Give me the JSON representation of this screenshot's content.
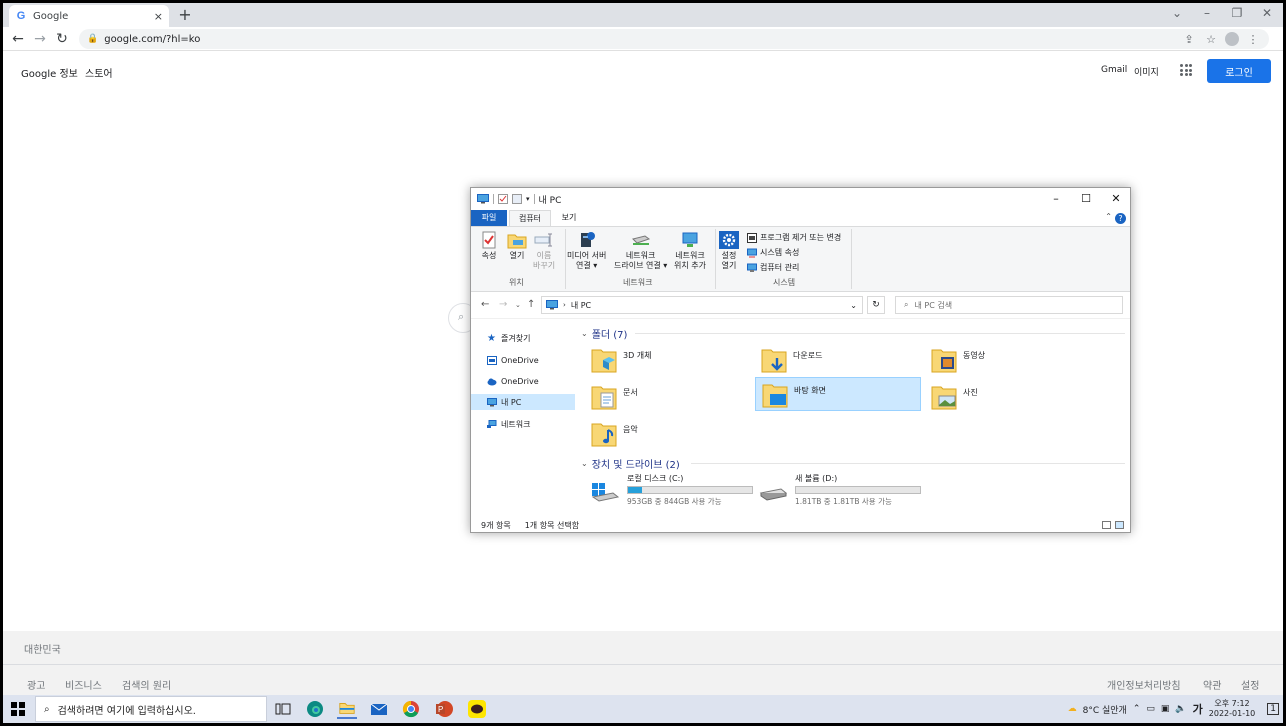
{
  "browser": {
    "tab_title": "Google",
    "tab_close": "×",
    "new_tab": "+",
    "url": "google.com/?hl=ko"
  },
  "google": {
    "about": "Google 정보",
    "store": "스토어",
    "gmail": "Gmail",
    "images": "이미지",
    "login": "로그인",
    "country": "대한민국",
    "footer_left": [
      "광고",
      "비즈니스",
      "검색의 원리"
    ],
    "footer_right": [
      "개인정보처리방침",
      "약관",
      "설정"
    ]
  },
  "explorer": {
    "title": "내 PC",
    "tabs": {
      "file": "파일",
      "computer": "컴퓨터",
      "view": "보기"
    },
    "ribbon": {
      "properties": "속성",
      "open": "열기",
      "rename_1": "이름",
      "rename_2": "바꾸기",
      "group_location": "위치",
      "media_server_1": "미디어 서버",
      "media_server_2": "연결 ▾",
      "network_drive_1": "네트워크",
      "network_drive_2": "드라이브 연결 ▾",
      "network_location_1": "네트워크",
      "network_location_2": "위치 추가",
      "group_network": "네트워크",
      "settings_1": "설정",
      "settings_2": "열기",
      "uninstall": "프로그램 제거 또는 변경",
      "system_props": "시스템 속성",
      "computer_mgmt": "컴퓨터 관리",
      "group_system": "시스템"
    },
    "address": "내 PC",
    "search_placeholder": "내 PC 검색",
    "nav": [
      "즐겨찾기",
      "OneDrive",
      "OneDrive",
      "내 PC",
      "네트워크"
    ],
    "folders_header": "폴더 (7)",
    "folders": [
      "3D 개체",
      "다운로드",
      "동영상",
      "문서",
      "바탕 화면",
      "사진",
      "음악"
    ],
    "drives_header": "장치 및 드라이브 (2)",
    "drives": [
      {
        "name": "로컬 디스크 (C:)",
        "size": "953GB 중 844GB 사용 가능",
        "used_fraction": 0.114
      },
      {
        "name": "새 볼륨 (D:)",
        "size": "1.81TB 중 1.81TB 사용 가능",
        "used_fraction": 0.0
      }
    ],
    "status_items": "9개 항목",
    "status_selected": "1개 항목 선택함"
  },
  "taskbar": {
    "search_placeholder": "검색하려면 여기에 입력하십시오.",
    "weather": "8°C  실안개",
    "ime": "가",
    "time": "오후 7:12",
    "date": "2022-01-10",
    "notifications": "1"
  },
  "colors": {
    "accent": "#1a73e8",
    "explorer_accent": "#1a64c2",
    "selection": "#cce8ff",
    "folder": "#f8d775"
  }
}
